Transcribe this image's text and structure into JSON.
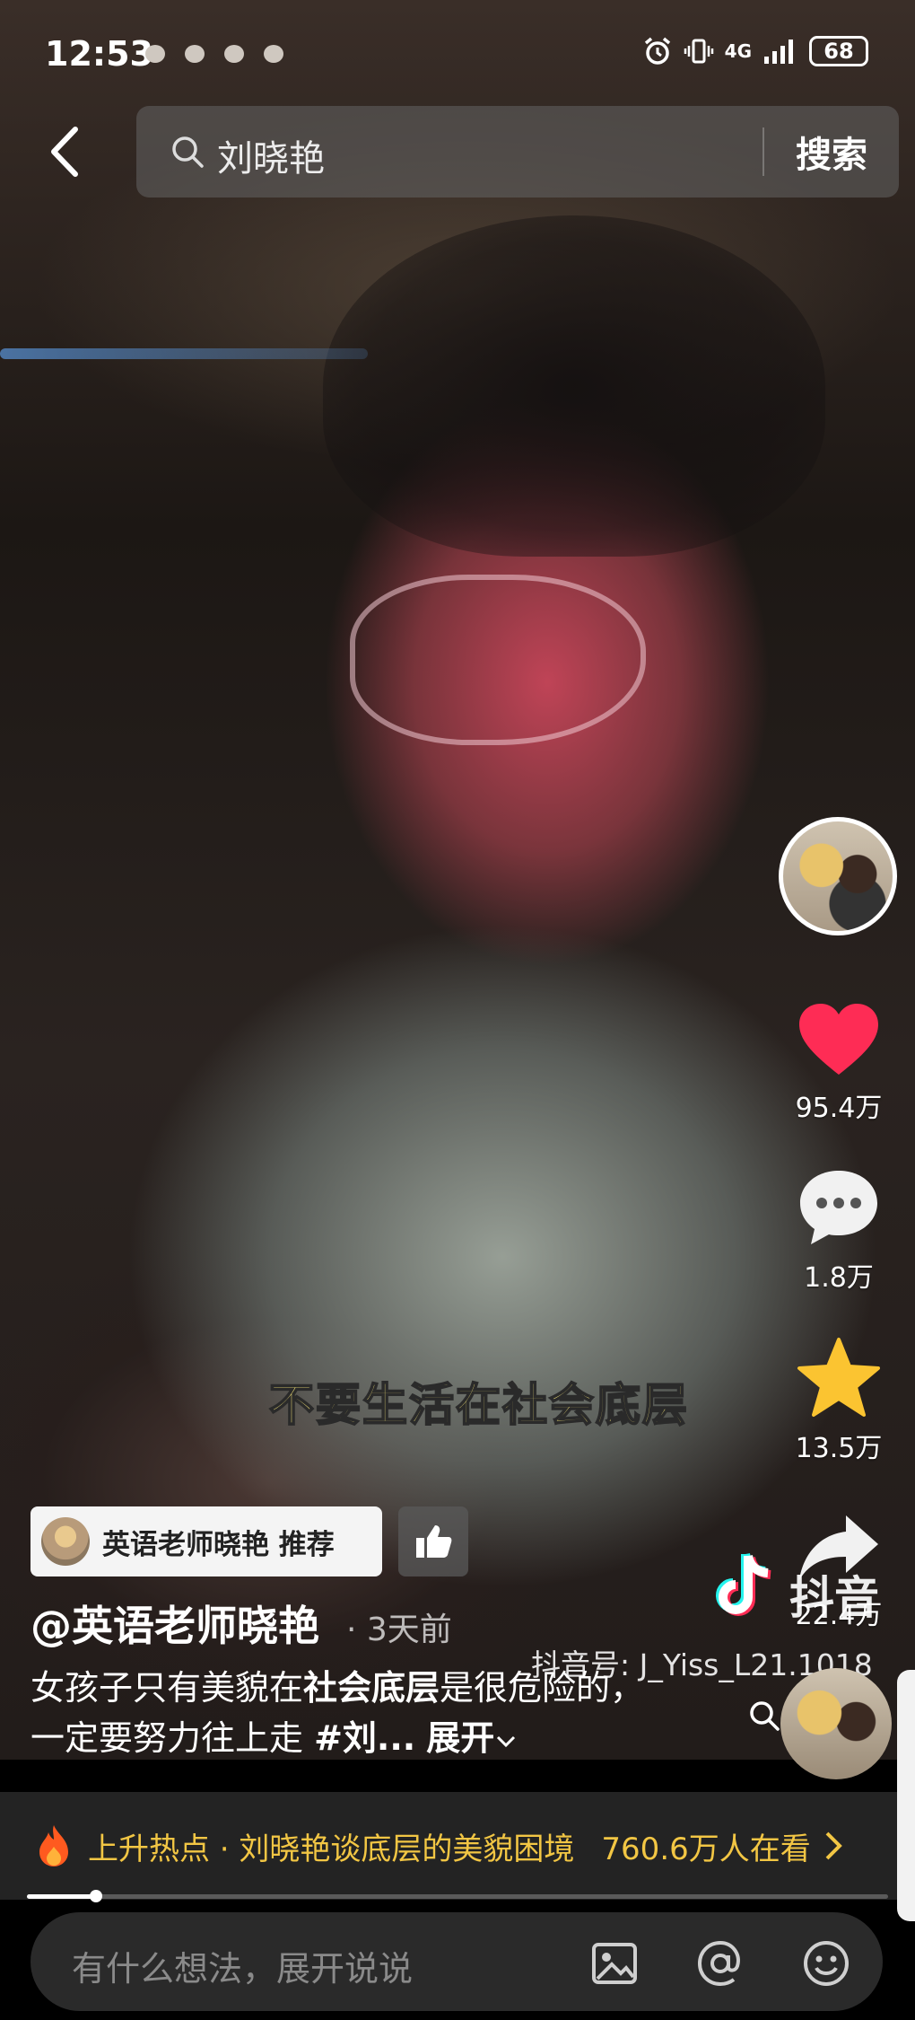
{
  "status_bar": {
    "time": "12:53",
    "network": "4G",
    "battery": "68"
  },
  "search": {
    "query": "刘晓艳",
    "button": "搜索"
  },
  "video": {
    "subtitle": "不要生活在社会底层"
  },
  "actions": {
    "like_count": "95.4万",
    "comment_count": "1.8万",
    "favorite_count": "13.5万",
    "share_count": "22.4万"
  },
  "recommend": {
    "label": "英语老师晓艳 推荐"
  },
  "author": {
    "handle": "@英语老师晓艳",
    "time": "· 3天前"
  },
  "description": {
    "part1": "女孩子只有美貌在",
    "bold1": "社会底层",
    "part2": "是很危险的，一定要努力往上走 ",
    "hashtag": "#刘...",
    "expand": "展开"
  },
  "watermark": {
    "brand": "抖音",
    "id": "抖音号: J_Yiss_L21.1018"
  },
  "hot": {
    "text": "上升热点 · 刘晓艳谈底层的美貌困境",
    "count": "760.6万人在看"
  },
  "progress": 0.08,
  "comment_input": {
    "placeholder": "有什么想法，展开说说"
  },
  "colors": {
    "like": "#fe2c55",
    "favorite": "#fbc431",
    "hot": "#f2c644"
  }
}
